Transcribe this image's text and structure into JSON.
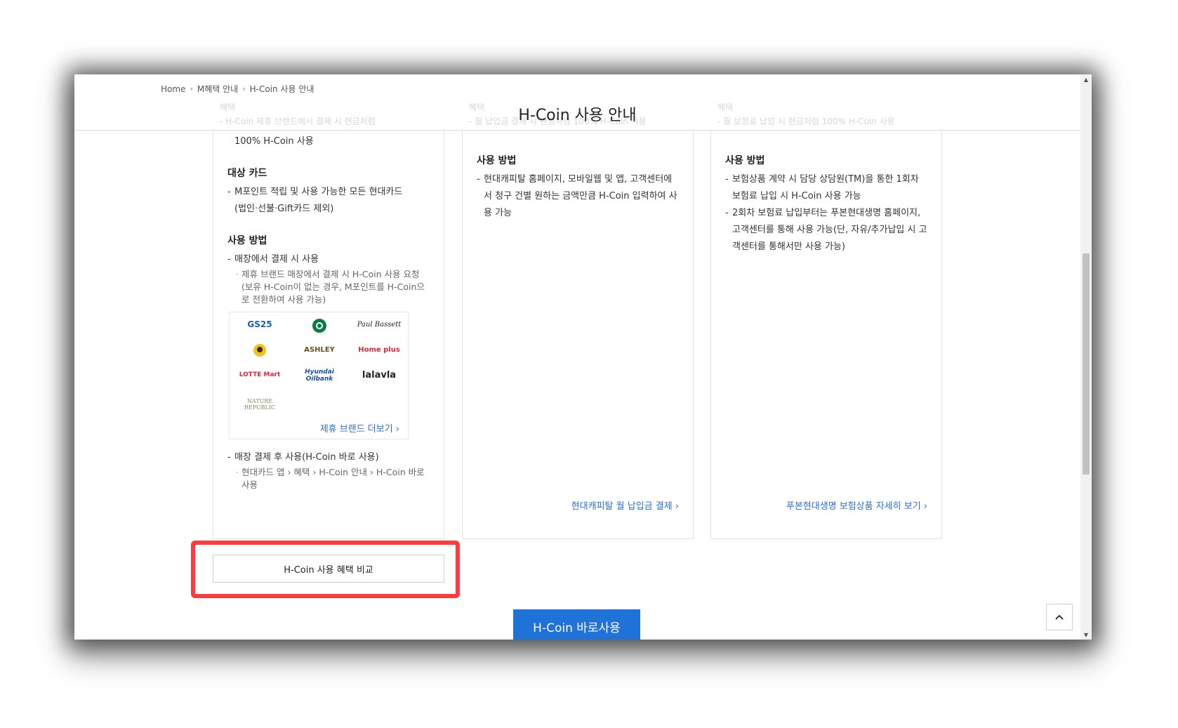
{
  "breadcrumb": {
    "home": "Home",
    "level1": "M혜택 안내",
    "level2": "H-Coin 사용 안내"
  },
  "page_title": "H-Coin 사용 안내",
  "ghost": {
    "c1_label": "혜택",
    "c1_text": "- H-Coin 제휴 브랜드에서 결제 시 현금처럼",
    "c2_label": "혜택",
    "c2_text": "- 월 납입금 결제 시 현금처럼 100% H-Coin 사용",
    "c3_label": "혜택",
    "c3_text": "- 월 보험료 납입 시 현금처럼 100% H-Coin 사용"
  },
  "card1": {
    "benefit_tail": "100% H-Coin 사용",
    "target_title": "대상 카드",
    "target_line1": "M포인트 적립 및 사용 가능한 모든 현대카드",
    "target_line2": "(법인·선불·Gift카드 제외)",
    "usage_title": "사용 방법",
    "usage_item1": "매장에서 결제 시 사용",
    "usage_item1_sub": "제휴 브랜드 매장에서 결제 시 H-Coin 사용 요청(보유 H-Coin이 없는 경우, M포인트를 H-Coin으로 전환하여 사용 가능)",
    "brands": {
      "gs25": "GS25",
      "starbucks": "STARBUCKS",
      "paulbassett": "Paul Bassett",
      "cafe": "",
      "ashley": "ASHLEY",
      "homeplus": "Home plus",
      "lottemart": "LOTTE Mart",
      "oilbank": "Hyundai Oilbank",
      "lalavla": "lalavla",
      "naturerepublic": "NATURE REPUBLIC"
    },
    "brand_more": "제휴 브랜드 더보기 ›",
    "usage_item2": "매장 결제 후 사용(H-Coin 바로 사용)",
    "usage_item2_sub": "현대카드 앱 › 혜택 › H-Coin 안내 › H-Coin 바로 사용"
  },
  "card2": {
    "usage_title": "사용 방법",
    "usage_text": "현대캐피탈 홈페이지, 모바일웹 및 앱, 고객센터에서 청구 건별 원하는 금액만큼 H-Coin 입력하여 사용 가능",
    "link": "현대캐피탈 월 납입금 결제 ›"
  },
  "card3": {
    "usage_title": "사용 방법",
    "usage_item1": "보험상품 계약 시 담당 상담원(TM)을 통한 1회차 보험료 납입 시 H-Coin 사용 가능",
    "usage_item2": "2회차 보험료 납입부터는 푸본현대생명 홈페이지, 고객센터를 통해 사용 가능(단, 자유/추가납입 시 고객센터를 통해서만 사용 가능)",
    "link": "푸본현대생명 보험상품 자세히 보기 ›"
  },
  "buttons": {
    "compare": "H-Coin 사용 혜택 비교",
    "use_now": "H-Coin 바로사용"
  },
  "colors": {
    "accent": "#1f73d8",
    "link": "#2a6fd6",
    "highlight": "#ff3b3b"
  }
}
